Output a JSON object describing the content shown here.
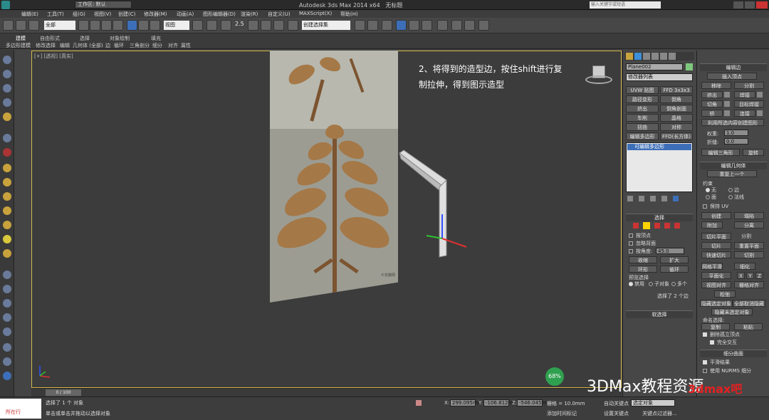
{
  "window": {
    "workspace": "工作区: 默认",
    "title": "Autodesk 3ds Max  2014 x64",
    "doc": "无标题",
    "search_placeholder": "输入关键字或短语"
  },
  "menu": [
    "编辑(E)",
    "工具(T)",
    "组(G)",
    "视图(V)",
    "创建(C)",
    "修改器(M)",
    "动画(A)",
    "图形编辑器(D)",
    "渲染(R)",
    "自定义(U)",
    "MAXScript(X)",
    "帮助(H)"
  ],
  "toolbar": {
    "filter": "全部",
    "view": "视图",
    "zoom_label": "2.5",
    "named_sel": "创建选择集"
  },
  "ribbon": {
    "tabs": [
      "建模",
      "自由形式",
      "选择",
      "对象绘制",
      "填充"
    ],
    "sub": [
      "多边形建模",
      "修改选择",
      "编辑",
      "几何体 (全部)",
      "边",
      "循环",
      "三角剖分",
      "细分",
      "对齐",
      "属性"
    ]
  },
  "viewport": {
    "label": "[+] [透视] [真实]",
    "annotation": "2、将得到的造型边，按住shift进行复制拉伸，得到图示造型",
    "image_caption": "©花瓣网"
  },
  "command_panel": {
    "object_name": "Plane002",
    "modifier_list": "修改器列表",
    "mod_buttons": [
      [
        "UVW 贴图",
        "FFD 3x3x3"
      ],
      [
        "路径变形",
        "倒角"
      ],
      [
        "挤出",
        "倒角剖面"
      ],
      [
        "车削",
        "晶格"
      ],
      [
        "扭曲",
        "对称"
      ],
      [
        "编辑多边形",
        "FFD(长方体)"
      ]
    ],
    "stack_item": "可编辑多边形",
    "selection_header": "选择",
    "by_vertex": "按顶点",
    "ignore_backface": "忽略背面",
    "by_angle": "按角度:",
    "angle_value": "45.0",
    "shrink": "收缩",
    "grow": "扩大",
    "ring": "环形",
    "loop": "循环",
    "preview_sel": "预览选择",
    "disabled": "禁用",
    "subobj": "子对象",
    "multi": "多个",
    "sel_status": "选择了 2 个边",
    "soft_sel": "软选择"
  },
  "right_panel": {
    "edit_edges_header": "编辑边",
    "insert_vertex": "插入顶点",
    "rows": [
      [
        "移除",
        "分割"
      ],
      [
        "挤出",
        "焊接"
      ],
      [
        "切角",
        "目标焊接"
      ],
      [
        "桥",
        "连接"
      ]
    ],
    "create_shape": "利用所选内容创建图形",
    "weight_label": "权重:",
    "weight_value": "1.0",
    "crease_label": "折缝:",
    "crease_value": "0.0",
    "edit_tri": "编辑三角形",
    "turn": "旋转",
    "edit_geom_header": "编辑几何体",
    "repeat_last": "重复上一个",
    "constraints": "约束",
    "c_none": "无",
    "c_edge": "边",
    "c_face": "面",
    "c_normal": "法线",
    "preserve_uv": "保持 UV",
    "create": "创建",
    "collapse": "塌陷",
    "attach": "附加",
    "detach": "分离",
    "slice_plane": "切片平面",
    "split": "分割",
    "slice": "切片",
    "reset_plane": "重置平面",
    "quickslice": "快速切片",
    "cut": "切割",
    "meshsmooth": "网格平滑",
    "tessellate": "细化",
    "make_planar": "平面化",
    "axes": [
      "X",
      "Y",
      "Z"
    ],
    "view_align": "视图对齐",
    "grid_align": "栅格对齐",
    "relax": "松弛",
    "hide_sel": "隐藏选定对象",
    "unhide_all": "全部取消隐藏",
    "hide_unsel": "隐藏未选定对象",
    "named_sel": "命名选择:",
    "copy": "复制",
    "paste": "粘贴",
    "delete_iso": "删除孤立顶点",
    "full_interact": "完全交互",
    "subdiv_header": "细分曲面",
    "smooth_result": "平滑结果",
    "use_nurms": "使用 NURMS 细分"
  },
  "timeline": {
    "frame": "0 / 100"
  },
  "status": {
    "left_tag": "所在行",
    "line1": "选择了 1 个 对象",
    "line2": "单击或单击并拖动以选择对象",
    "x_label": "X:",
    "x_value": "299.095mm",
    "y_label": "Y:",
    "y_value": "-106.812m",
    "z_label": "Z:",
    "z_value": "-546.045m",
    "grid": "栅格 = 10.0mm",
    "add_time_tag": "添加时间标记",
    "autokey": "自动关键点",
    "sel_obj": "选定对象",
    "setkey": "设置关键点",
    "key_filters": "关键点过滤器...",
    "progress": "68%"
  },
  "watermark": {
    "text": "3DMax教程资源",
    "red": "3dmax吧"
  }
}
